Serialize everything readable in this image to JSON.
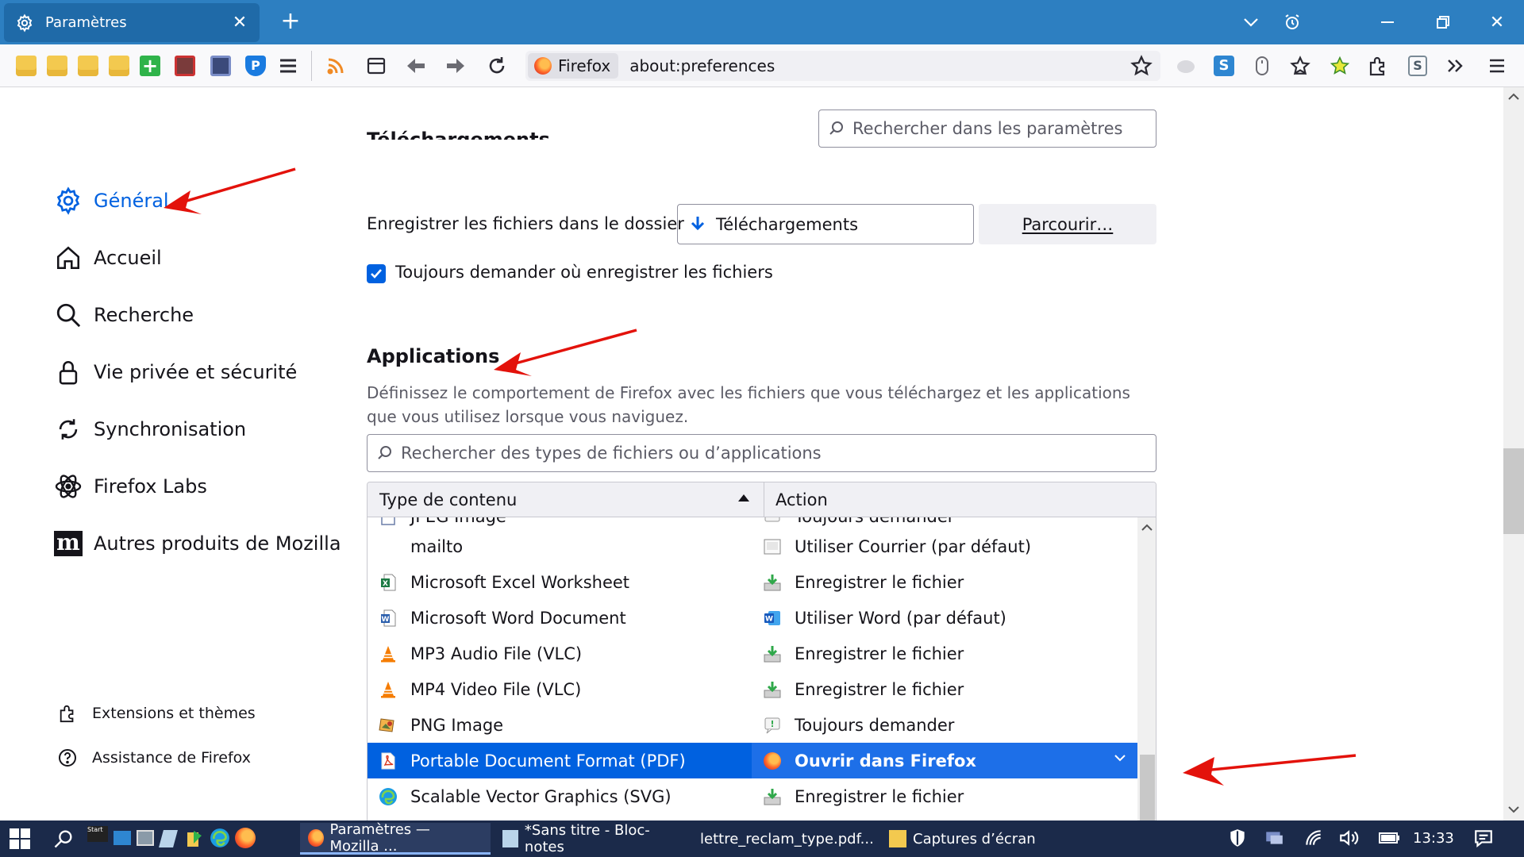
{
  "window": {
    "tab_title": "Paramètres",
    "new_tab_icon": "plus-icon",
    "colors": {
      "titlebar": "#2d7fc1",
      "accent": "#0061e0",
      "arrow": "#e3120b"
    }
  },
  "navbar": {
    "identity_label": "Firefox",
    "url": "about:preferences"
  },
  "search": {
    "placeholder": "Rechercher dans les paramètres"
  },
  "sidebar": {
    "items": [
      {
        "label": "Général",
        "icon": "gear-icon",
        "selected": true
      },
      {
        "label": "Accueil",
        "icon": "home-icon"
      },
      {
        "label": "Recherche",
        "icon": "search-icon"
      },
      {
        "label": "Vie privée et sécurité",
        "icon": "lock-icon"
      },
      {
        "label": "Synchronisation",
        "icon": "sync-icon"
      },
      {
        "label": "Firefox Labs",
        "icon": "labs-icon"
      },
      {
        "label": "Autres produits de Mozilla",
        "icon": "mozilla-icon"
      }
    ],
    "footer": [
      {
        "label": "Extensions et thèmes",
        "icon": "puzzle-icon"
      },
      {
        "label": "Assistance de Firefox",
        "icon": "help-icon"
      }
    ]
  },
  "downloads": {
    "heading": "Téléchargements",
    "save_label": "Enregistrer les fichiers dans le dossier",
    "folder": "Téléchargements",
    "browse": "Parcourir…",
    "always_ask": "Toujours demander où enregistrer les fichiers",
    "always_ask_checked": true
  },
  "applications": {
    "heading": "Applications",
    "description": "Définissez le comportement de Firefox avec les fichiers que vous téléchargez et les applications que vous utilisez lorsque vous naviguez.",
    "filter_placeholder": "Rechercher des types de fichiers ou d’applications",
    "col_type": "Type de contenu",
    "col_action": "Action",
    "rows": [
      {
        "type": "JPEG Image",
        "action": "Toujours demander"
      },
      {
        "type": "mailto",
        "action": "Utiliser Courrier (par défaut)"
      },
      {
        "type": "Microsoft Excel Worksheet",
        "action": "Enregistrer le fichier"
      },
      {
        "type": "Microsoft Word Document",
        "action": "Utiliser Word (par défaut)"
      },
      {
        "type": "MP3 Audio File (VLC)",
        "action": "Enregistrer le fichier"
      },
      {
        "type": "MP4 Video File (VLC)",
        "action": "Enregistrer le fichier"
      },
      {
        "type": "PNG Image",
        "action": "Toujours demander"
      },
      {
        "type": "Portable Document Format (PDF)",
        "action": "Ouvrir dans Firefox",
        "selected": true
      },
      {
        "type": "Scalable Vector Graphics (SVG)",
        "action": "Enregistrer le fichier"
      }
    ]
  },
  "taskbar": {
    "start_label": "Start",
    "items": [
      {
        "label": "Paramètres — Mozilla ...",
        "active": true
      },
      {
        "label": "*Sans titre - Bloc-notes"
      },
      {
        "label": "lettre_reclam_type.pdf..."
      },
      {
        "label": "Captures d’écran"
      }
    ],
    "clock": "13:33"
  }
}
